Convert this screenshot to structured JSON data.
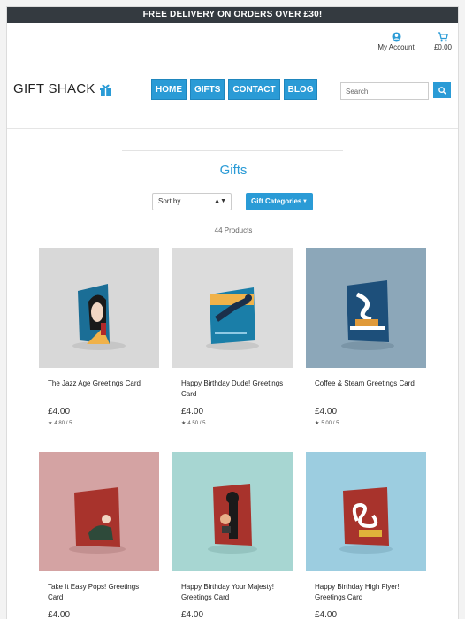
{
  "banner": "FREE DELIVERY ON ORDERS OVER £30!",
  "account_label": "My Account",
  "cart_total": "£0.00",
  "logo": "GIFT SHACK",
  "nav": [
    "HOME",
    "GIFTS",
    "CONTACT",
    "BLOG"
  ],
  "search_placeholder": "Search",
  "page_title": "Gifts",
  "sort_label": "Sort by...",
  "categories_label": "Gift Categories",
  "product_count": "44 Products",
  "colors": {
    "accent": "#2a9bd6",
    "banner_bg": "#343a40"
  },
  "products": [
    {
      "name": "The Jazz Age Greetings Card",
      "price": "£4.00",
      "rating": "4.80 / 5",
      "bg": "#d9d9d9"
    },
    {
      "name": "Happy Birthday Dude! Greetings Card",
      "price": "£4.00",
      "rating": "4.50 / 5",
      "bg": "#dcdcdc"
    },
    {
      "name": "Coffee & Steam Greetings Card",
      "price": "£4.00",
      "rating": "5.00 / 5",
      "bg": "#8ba6b8"
    },
    {
      "name": "Take It Easy Pops! Greetings Card",
      "price": "£4.00",
      "rating": "",
      "bg": "#d4a2a2"
    },
    {
      "name": "Happy Birthday Your Majesty! Greetings Card",
      "price": "£4.00",
      "rating": "",
      "bg": "#a6d6d2"
    },
    {
      "name": "Happy Birthday High Flyer! Greetings Card",
      "price": "£4.00",
      "rating": "",
      "bg": "#9ccce0"
    }
  ]
}
